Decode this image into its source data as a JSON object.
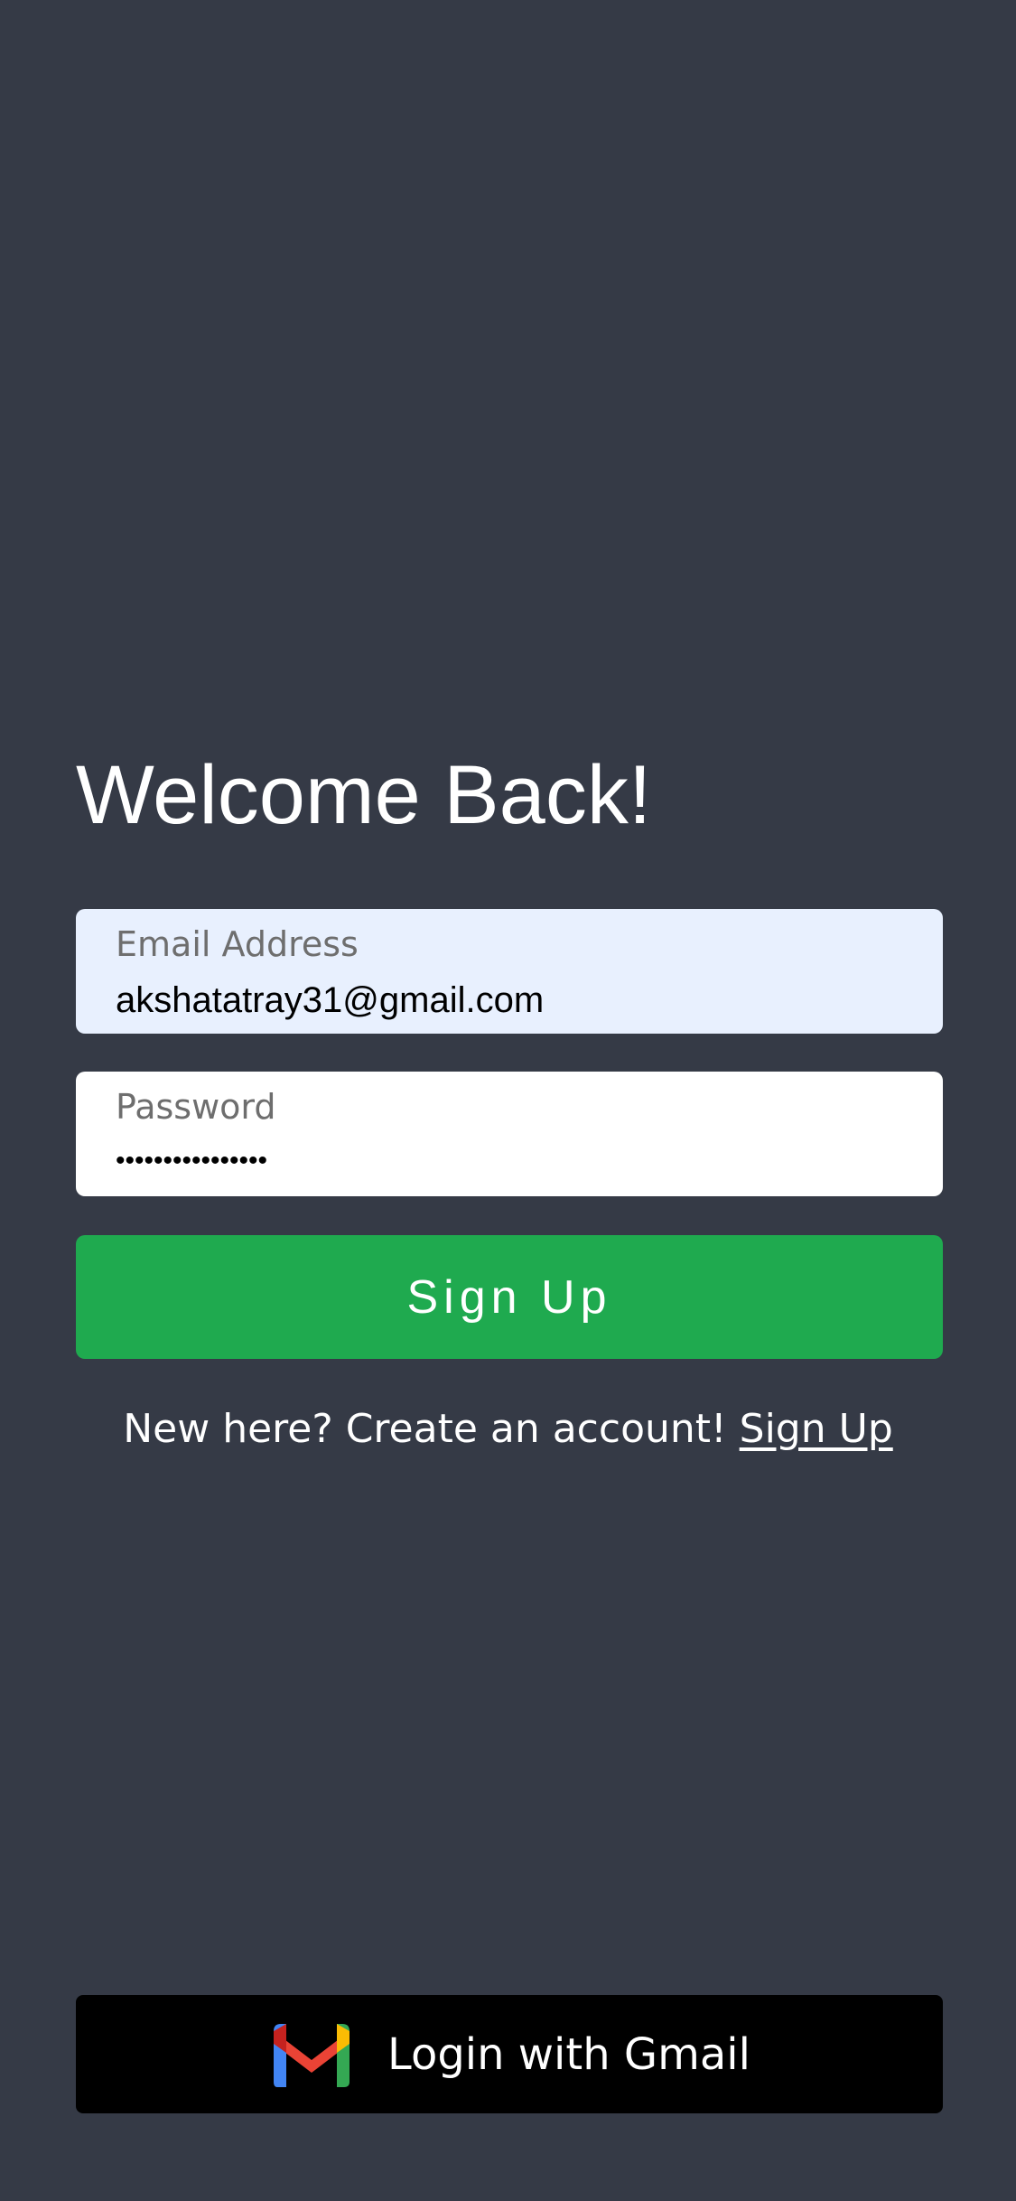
{
  "page": {
    "title": "Welcome Back!"
  },
  "form": {
    "email": {
      "label": "Email Address",
      "value": "akshatatray31@gmail.com"
    },
    "password": {
      "label": "Password",
      "value": "••••••••••••••••"
    },
    "submit_label": "Sign Up"
  },
  "signup_prompt": {
    "text": "New here? Create an account!",
    "link_label": "Sign Up"
  },
  "gmail_login": {
    "label": "Login with Gmail",
    "icon": "gmail-icon"
  },
  "colors": {
    "background": "#353a46",
    "primary_button": "#1faa4f",
    "email_field": "#e8f0fe",
    "password_field": "#ffffff",
    "gmail_button": "#000000"
  }
}
